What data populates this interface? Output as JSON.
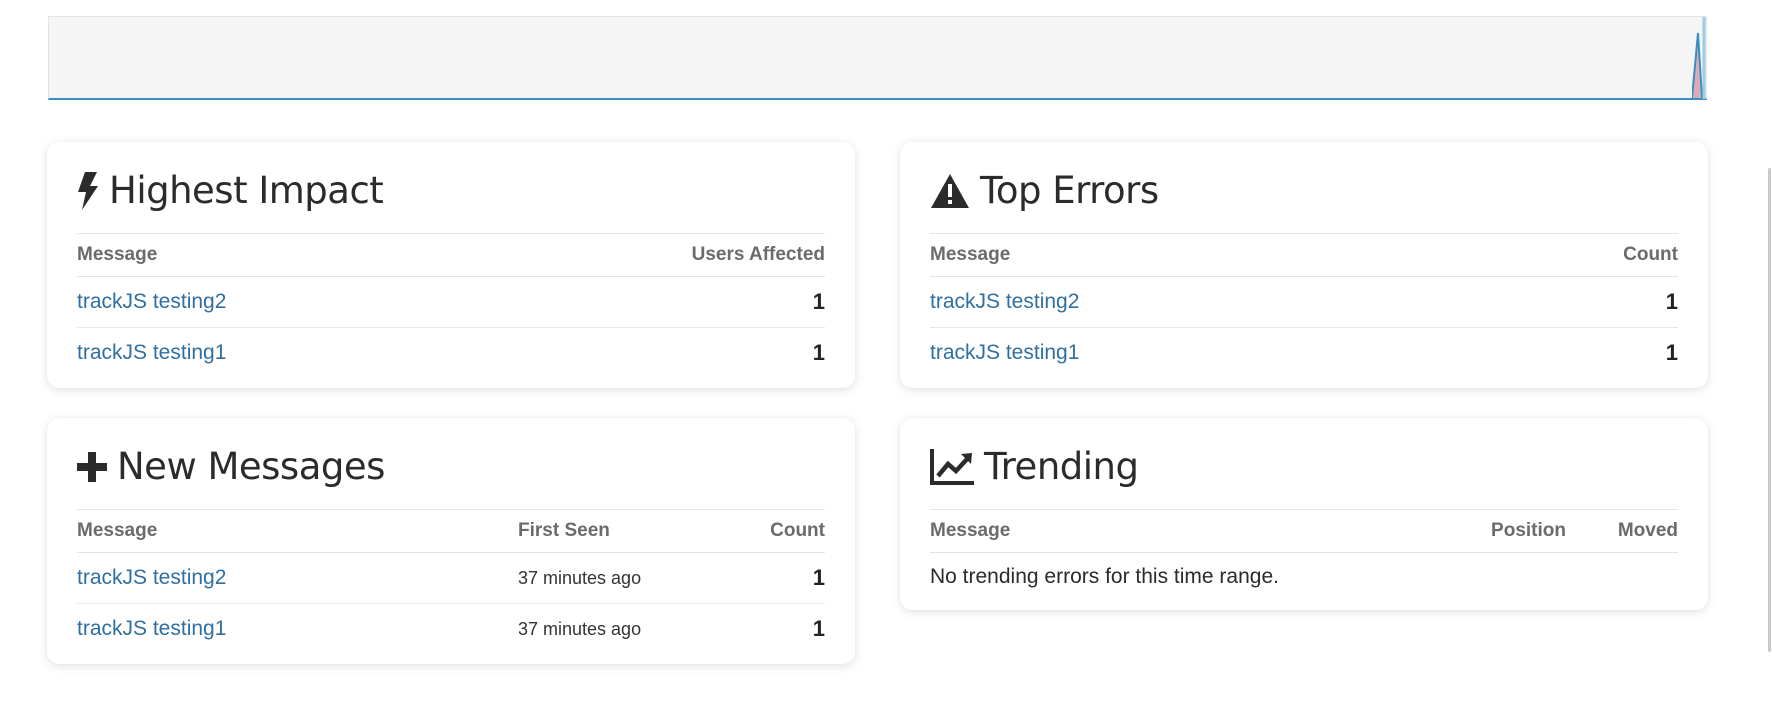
{
  "colors": {
    "link": "#2f6fa3",
    "chart_line": "#3a8ec2",
    "chart_spike": "#d9535f"
  },
  "highest_impact": {
    "icon": "bolt-icon",
    "title": "Highest Impact",
    "columns": [
      "Message",
      "Users Affected"
    ],
    "rows": [
      {
        "message": "trackJS testing2",
        "value": "1"
      },
      {
        "message": "trackJS testing1",
        "value": "1"
      }
    ]
  },
  "top_errors": {
    "icon": "warning-icon",
    "title": "Top Errors",
    "columns": [
      "Message",
      "Count"
    ],
    "rows": [
      {
        "message": "trackJS testing2",
        "value": "1"
      },
      {
        "message": "trackJS testing1",
        "value": "1"
      }
    ]
  },
  "new_messages": {
    "icon": "plus-icon",
    "title": "New Messages",
    "columns": [
      "Message",
      "First Seen",
      "Count"
    ],
    "rows": [
      {
        "message": "trackJS testing2",
        "first_seen": "37 minutes ago",
        "value": "1"
      },
      {
        "message": "trackJS testing1",
        "first_seen": "37 minutes ago",
        "value": "1"
      }
    ]
  },
  "trending": {
    "icon": "trending-up-icon",
    "title": "Trending",
    "columns": [
      "Message",
      "Position",
      "Moved"
    ],
    "empty_text": "No trending errors for this time range."
  }
}
